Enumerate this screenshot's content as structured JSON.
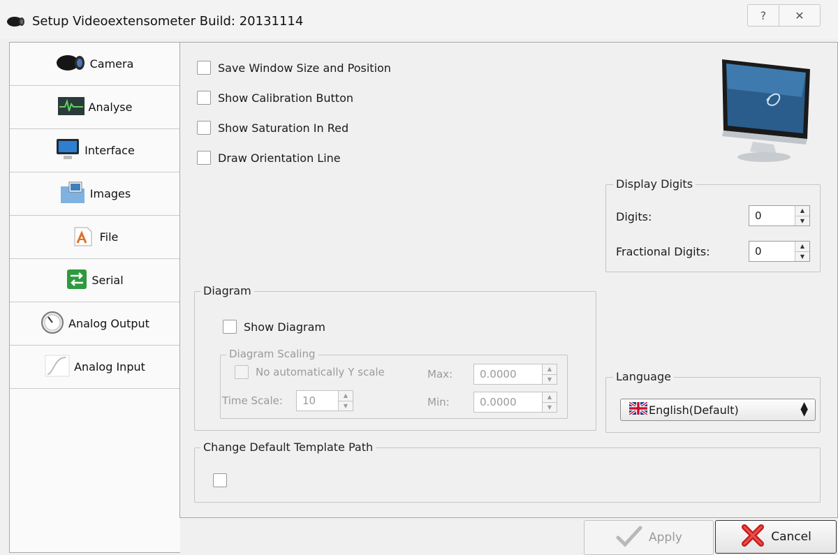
{
  "window": {
    "title": "Setup Videoextensometer Build: 20131114",
    "help_label": "?",
    "close_label": "✕"
  },
  "sidebar": {
    "items": [
      {
        "label": "Camera",
        "icon": "camera-icon"
      },
      {
        "label": "Analyse",
        "icon": "analyse-icon"
      },
      {
        "label": "Interface",
        "icon": "monitor-icon"
      },
      {
        "label": "Images",
        "icon": "images-icon"
      },
      {
        "label": "File",
        "icon": "file-icon"
      },
      {
        "label": "Serial",
        "icon": "serial-icon"
      },
      {
        "label": "Analog Output",
        "icon": "gauge-icon"
      },
      {
        "label": "Analog Input",
        "icon": "analog-input-icon"
      }
    ]
  },
  "interface": {
    "options": [
      {
        "label": "Save Window Size and Position",
        "checked": false
      },
      {
        "label": "Show Calibration Button",
        "checked": false
      },
      {
        "label": "Show Saturation In Red",
        "checked": false
      },
      {
        "label": "Draw Orientation Line",
        "checked": false
      }
    ],
    "display_digits": {
      "title": "Display Digits",
      "digits_label": "Digits:",
      "digits_value": "0",
      "fractional_label": "Fractional Digits:",
      "fractional_value": "0"
    },
    "diagram": {
      "title": "Diagram",
      "show_label": "Show Diagram",
      "scaling_title": "Diagram Scaling",
      "no_auto_y_label": "No automatically Y scale",
      "time_scale_label": "Time Scale:",
      "time_scale_value": "10",
      "max_label": "Max:",
      "max_value": "0.0000",
      "min_label": "Min:",
      "min_value": "0.0000"
    },
    "language": {
      "title": "Language",
      "selected": "English(Default)"
    },
    "template_path": {
      "title": "Change Default Template Path"
    }
  },
  "footer": {
    "apply_label": "Apply",
    "cancel_label": "Cancel"
  }
}
